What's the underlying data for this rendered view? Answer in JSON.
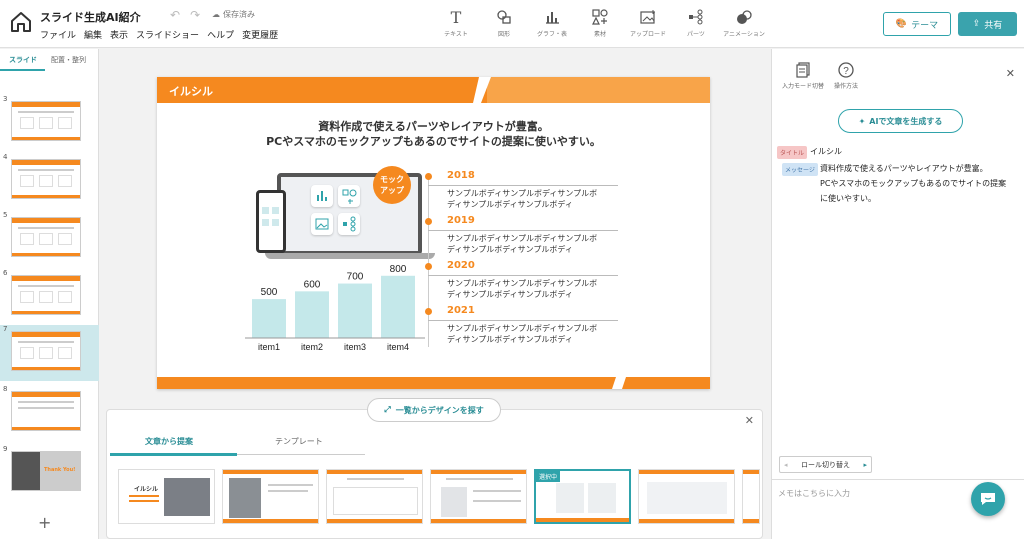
{
  "header": {
    "title": "スライド生成AI紹介",
    "save_status": "保存済み",
    "menu": [
      "ファイル",
      "編集",
      "表示",
      "スライドショー",
      "ヘルプ",
      "変更履歴"
    ],
    "tools": [
      {
        "label": "テキスト",
        "icon": "text-icon"
      },
      {
        "label": "図形",
        "icon": "shapes-icon"
      },
      {
        "label": "グラフ・表",
        "icon": "chart-icon"
      },
      {
        "label": "素材",
        "icon": "assets-icon"
      },
      {
        "label": "アップロード",
        "icon": "upload-icon"
      },
      {
        "label": "パーツ",
        "icon": "parts-icon"
      },
      {
        "label": "アニメーション",
        "icon": "animation-icon"
      }
    ],
    "theme_label": "テーマ",
    "share_label": "共有"
  },
  "left_panel": {
    "tabs": [
      "スライド",
      "配置・整列"
    ],
    "slides": [
      {
        "num": "3"
      },
      {
        "num": "4"
      },
      {
        "num": "5"
      },
      {
        "num": "6"
      },
      {
        "num": "7"
      },
      {
        "num": "8"
      },
      {
        "num": "9",
        "text": "Thank You!"
      }
    ],
    "add_label": "+"
  },
  "slide": {
    "title": "イルシル",
    "message_line1": "資料作成で使えるパーツやレイアウトが豊富。",
    "message_line2": "PCやスマホのモックアップもあるのでサイトの提案に使いやすい。",
    "badge_line1": "モック",
    "badge_line2": "アップ",
    "timeline": [
      {
        "year": "2018",
        "line1": "サンプルボディサンプルボディサンプルボ",
        "line2": "ディサンプルボディサンプルボディ"
      },
      {
        "year": "2019",
        "line1": "サンプルボディサンプルボディサンプルボ",
        "line2": "ディサンプルボディサンプルボディ"
      },
      {
        "year": "2020",
        "line1": "サンプルボディサンプルボディサンプルボ",
        "line2": "ディサンプルボディサンプルボディ"
      },
      {
        "year": "2021",
        "line1": "サンプルボディサンプルボディサンプルボ",
        "line2": "ディサンプルボディサンプルボディ"
      }
    ]
  },
  "chart_data": {
    "type": "bar",
    "categories": [
      "item1",
      "item2",
      "item3",
      "item4"
    ],
    "values": [
      500,
      600,
      700,
      800
    ],
    "ylim": [
      0,
      900
    ],
    "color": "#c4e8ea"
  },
  "explore_label": "一覧からデザインを探す",
  "bottom_panel": {
    "tabs": [
      "文章から提案",
      "テンプレート"
    ],
    "selected_tag": "選択中",
    "first_template_title": "イルシル"
  },
  "right_panel": {
    "input_mode_label": "入力モード切替",
    "help_label": "操作方法",
    "ai_button": "AIで文章を生成する",
    "role_title": "タイトル",
    "role_message": "メッセージ",
    "title_text": "イルシル",
    "message_line1": "資料作成で使えるパーツやレイアウトが豊富。",
    "message_line2": "PCやスマホのモックアップもあるのでサイトの提案",
    "message_line3": "に使いやすい。",
    "role_switch": "ロール切り替え",
    "memo_placeholder": "メモはこちらに入力"
  },
  "colors": {
    "accent": "#f5891f",
    "teal": "#2fa3ab",
    "bar": "#c4e8ea"
  }
}
